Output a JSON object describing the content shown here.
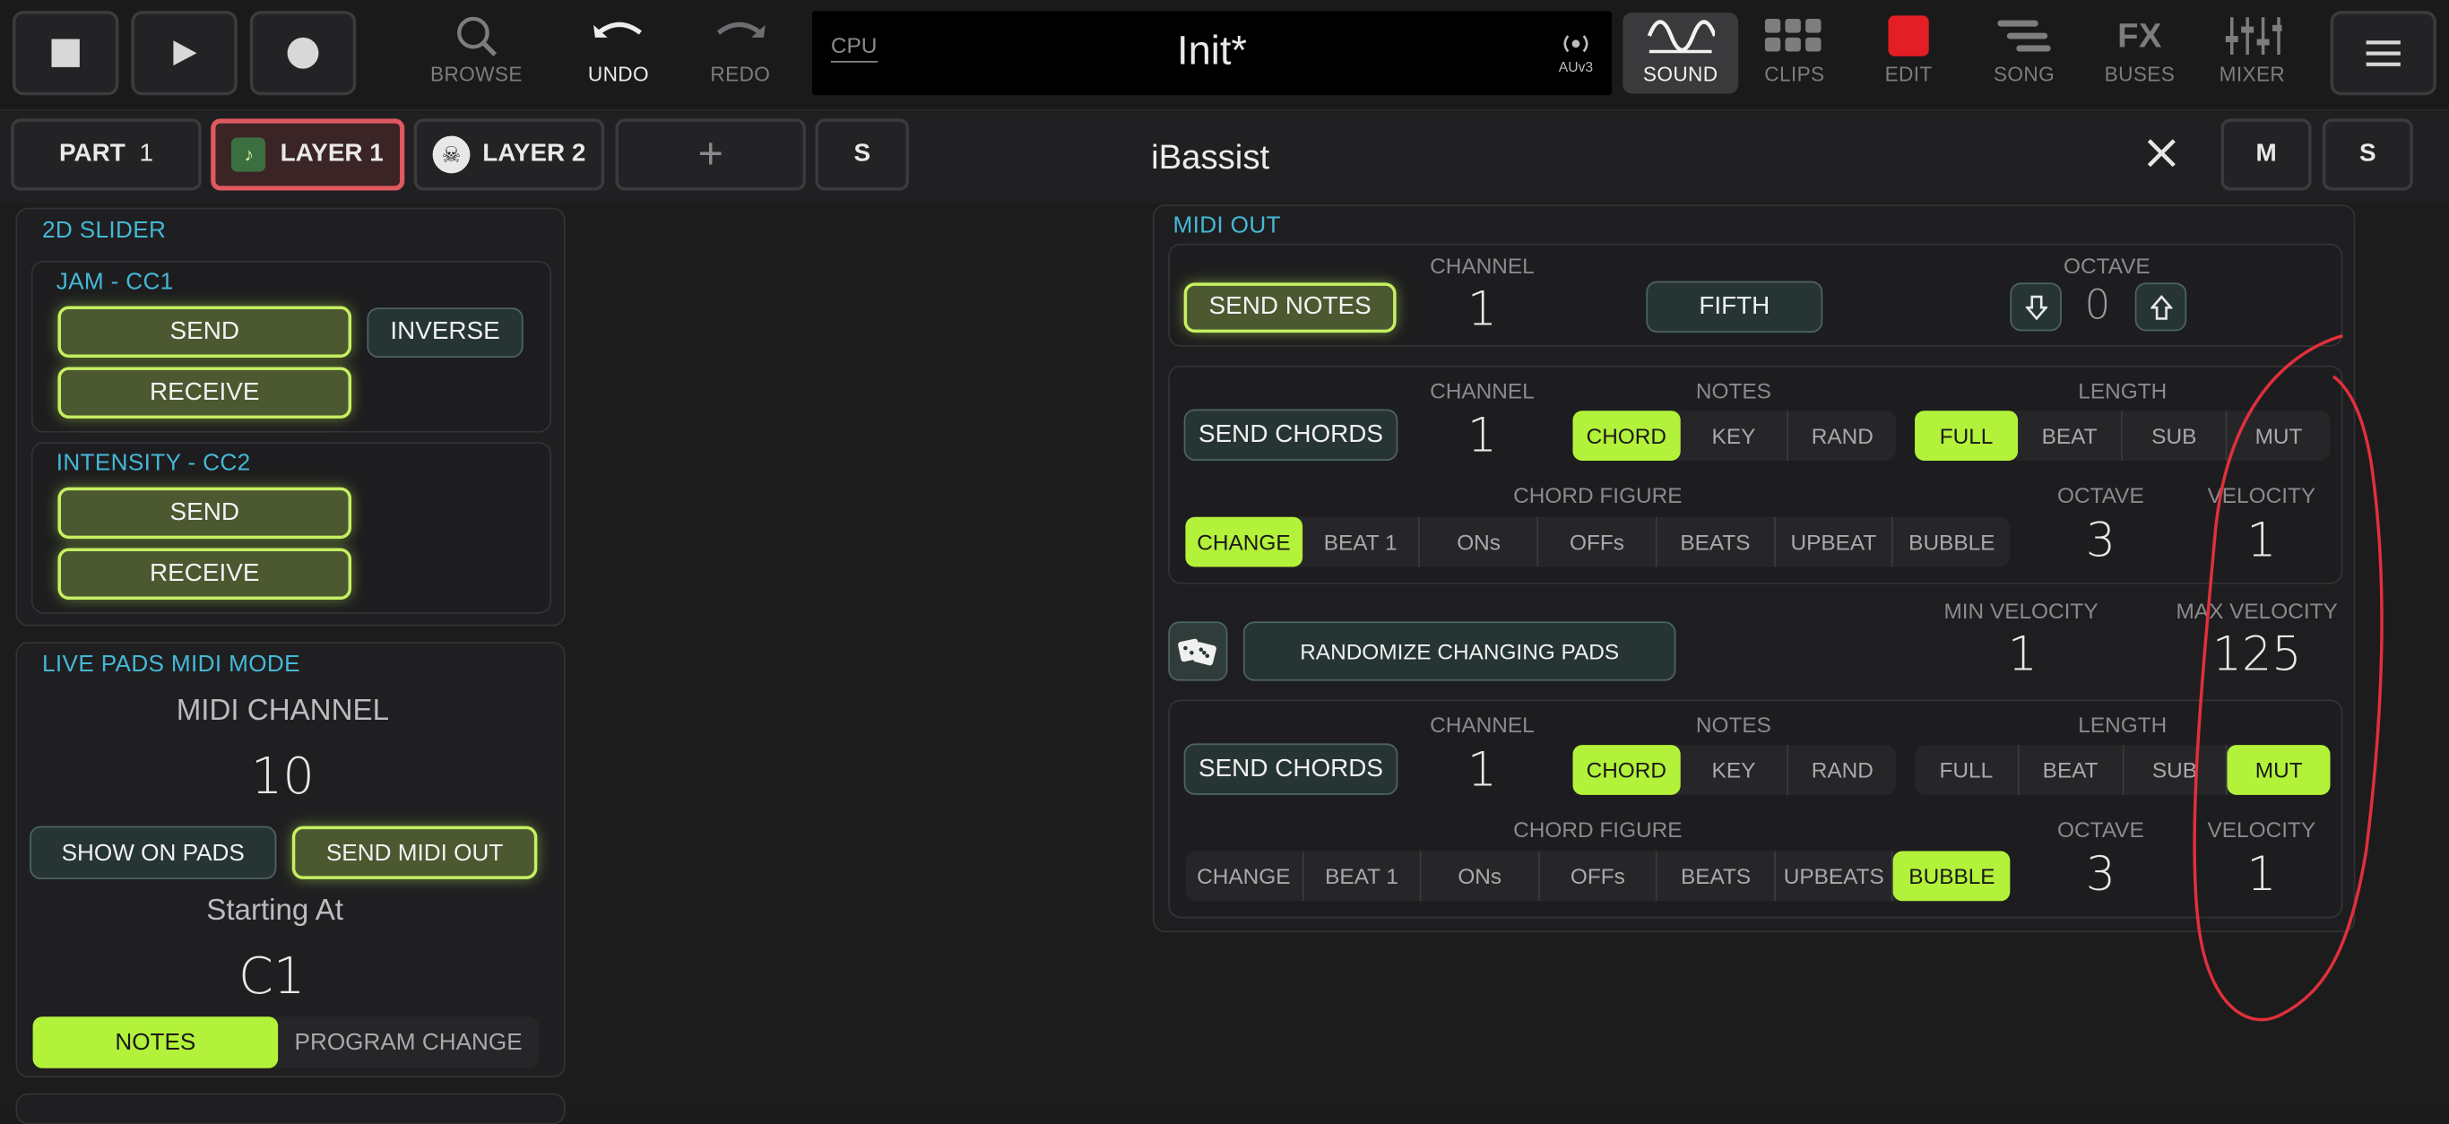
{
  "colors": {
    "accent": "#b3f23a",
    "section": "#45b8d6",
    "edit_red": "#e31e24",
    "annotation": "#e0303c"
  },
  "transport": {
    "stop": "stop-icon",
    "play": "play-icon",
    "record": "record-icon"
  },
  "nav": {
    "browse": "BROWSE",
    "undo": "UNDO",
    "redo": "REDO",
    "sound": "SOUND",
    "clips": "CLIPS",
    "edit": "EDIT",
    "song": "SONG",
    "fx_icon": "FX",
    "buses": "BUSES",
    "mixer": "MIXER"
  },
  "display": {
    "cpu": "CPU",
    "title": "Init*",
    "auv3": "AUv3"
  },
  "tabs": {
    "part_label": "PART",
    "part_num": "1",
    "layer1": "LAYER 1",
    "layer2": "LAYER 2",
    "add": "+",
    "solo": "S"
  },
  "plugin": {
    "name": "iBassist",
    "mute": "M",
    "solo": "S"
  },
  "slider2d": {
    "title": "2D SLIDER",
    "jam": {
      "title": "JAM - CC1",
      "send": "SEND",
      "inverse": "INVERSE",
      "receive": "RECEIVE"
    },
    "intensity": {
      "title": "INTENSITY - CC2",
      "send": "SEND",
      "receive": "RECEIVE"
    }
  },
  "live_pads": {
    "title": "LIVE PADS MIDI MODE",
    "midi_channel_label": "MIDI CHANNEL",
    "midi_channel": "10",
    "show_on_pads": "SHOW ON PADS",
    "send_midi_out": "SEND MIDI OUT",
    "starting_at_label": "Starting At",
    "starting_at": "C1",
    "notes": "NOTES",
    "program_change": "PROGRAM CHANGE"
  },
  "midi_out": {
    "title": "MIDI OUT",
    "row1": {
      "send_notes": "SEND NOTES",
      "channel_label": "CHANNEL",
      "channel": "1",
      "fifth": "FIFTH",
      "octave_label": "OCTAVE",
      "octave": "0"
    },
    "chords1": {
      "send": "SEND CHORDS",
      "channel_label": "CHANNEL",
      "channel": "1",
      "notes_label": "NOTES",
      "notes": [
        "CHORD",
        "KEY",
        "RAND"
      ],
      "notes_selected": "CHORD",
      "length_label": "LENGTH",
      "length": [
        "FULL",
        "BEAT",
        "SUB",
        "MUT"
      ],
      "length_selected": "FULL",
      "figure_label": "CHORD FIGURE",
      "figure": [
        "CHANGE",
        "BEAT 1",
        "ONs",
        "OFFs",
        "BEATS",
        "UPBEAT",
        "BUBBLE"
      ],
      "figure_selected": "CHANGE",
      "octave_label": "OCTAVE",
      "octave": "3",
      "velocity_label": "VELOCITY",
      "velocity": "1"
    },
    "randomize": {
      "button": "RANDOMIZE CHANGING PADS",
      "dice": "dice-icon",
      "min_label": "MIN VELOCITY",
      "min": "1",
      "max_label": "MAX VELOCITY",
      "max": "125"
    },
    "chords2": {
      "send": "SEND CHORDS",
      "channel_label": "CHANNEL",
      "channel": "1",
      "notes_label": "NOTES",
      "notes": [
        "CHORD",
        "KEY",
        "RAND"
      ],
      "notes_selected": "CHORD",
      "length_label": "LENGTH",
      "length": [
        "FULL",
        "BEAT",
        "SUB",
        "MUT"
      ],
      "length_selected": "MUT",
      "figure_label": "CHORD FIGURE",
      "figure": [
        "CHANGE",
        "BEAT 1",
        "ONs",
        "OFFs",
        "BEATS",
        "UPBEATS",
        "BUBBLE"
      ],
      "figure_selected": "BUBBLE",
      "octave_label": "OCTAVE",
      "octave": "3",
      "velocity_label": "VELOCITY",
      "velocity": "1"
    }
  }
}
